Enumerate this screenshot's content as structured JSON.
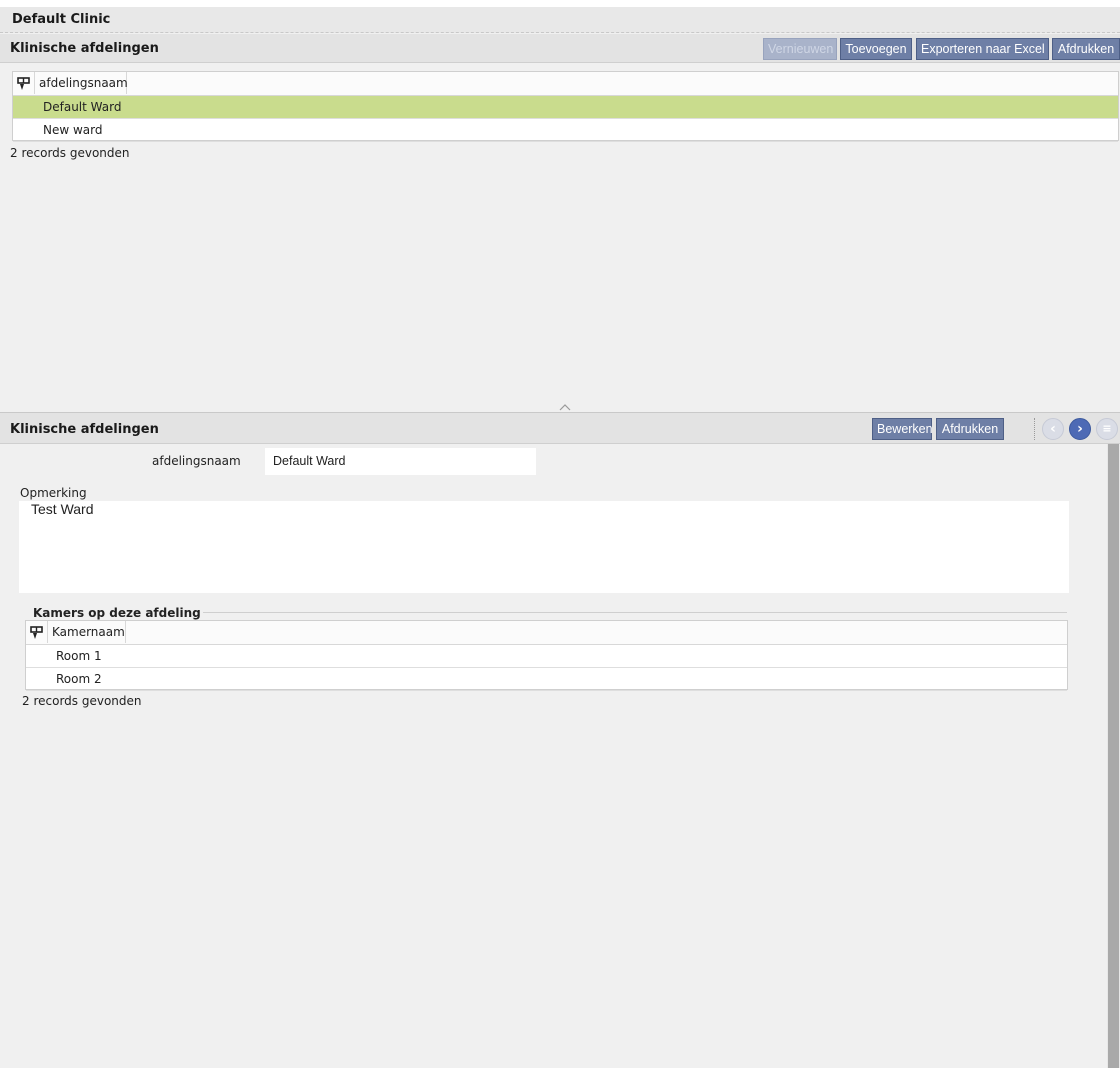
{
  "app": {
    "title": "Default Clinic"
  },
  "list_section": {
    "title": "Klinische afdelingen",
    "buttons": {
      "refresh": "Vernieuwen",
      "add": "Toevoegen",
      "export": "Exporteren naar Excel",
      "print": "Afdrukken"
    },
    "column_header": "afdelingsnaam",
    "rows": [
      "Default Ward",
      "New ward"
    ],
    "selected_row": "Default Ward",
    "record_count": "2 records gevonden"
  },
  "detail_section": {
    "title": "Klinische afdelingen",
    "buttons": {
      "edit": "Bewerken",
      "print": "Afdrukken"
    },
    "nav_icons": [
      "chevron-left-icon",
      "chevron-right-icon",
      "list-icon"
    ],
    "field_label": "afdelingsnaam",
    "field_value": "Default Ward",
    "remark_label": "Opmerking",
    "remark_value": "Test Ward",
    "rooms": {
      "legend": "Kamers op deze afdeling",
      "column_header": "Kamernaam",
      "rows": [
        "Room 1",
        "Room 2"
      ],
      "record_count": "2 records gevonden"
    }
  },
  "colors": {
    "button_bg": "#6e7fa6",
    "selected_row_bg": "#c9dc8d",
    "nav_active": "#4d6ab5",
    "nav_inactive": "#d6d9e3"
  }
}
